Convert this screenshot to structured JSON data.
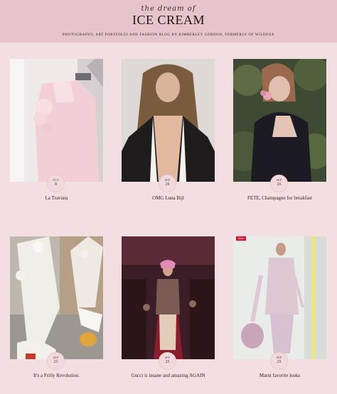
{
  "header": {
    "logo_script": "the dream of",
    "logo_main": "ICE CREAM",
    "tagline": "PHOTOGRAPHY, ART PORTFOLIO AND FASHION BLOG BY KIMBERLEY GORDON, FORMERLY OF WILDFOX"
  },
  "posts": [
    {
      "title": "La Traviata",
      "month": "OCT",
      "day": "8"
    },
    {
      "title": "OMG Luna Bijl",
      "month": "SEP",
      "day": "26"
    },
    {
      "title": "FETE, Champagne for breakfast",
      "month": "SEP",
      "day": "26"
    },
    {
      "title": "It's a Frilly Revolution.",
      "month": "SEP",
      "day": "25"
    },
    {
      "title": "Gucci is insane and amazing AGAIN",
      "month": "SEP",
      "day": "25"
    },
    {
      "title": "Marni favorite looks",
      "month": "SEP",
      "day": "25",
      "badge": "Save"
    }
  ],
  "colors": {
    "header_bg": "#e6c4cb",
    "page_bg": "#f3dee2",
    "save_badge": "#e10c2d"
  }
}
